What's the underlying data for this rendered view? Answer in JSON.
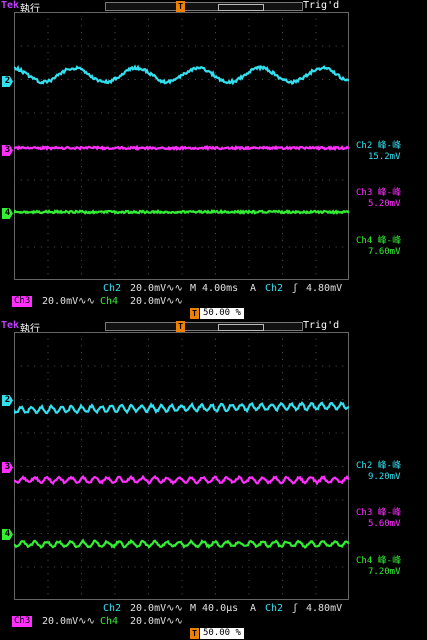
{
  "colors": {
    "ch2": "#33e0f0",
    "ch3": "#ff30ff",
    "ch4": "#33ee33",
    "tek": "#c040ff",
    "trigger": "#f08000"
  },
  "panels": [
    {
      "brand": "Tek",
      "run_state": "執行",
      "trig_state": "Trig'd",
      "trig_marker_label": "T",
      "trig_position": "",
      "channels": [
        {
          "label": "2",
          "wave": "sine-slow"
        },
        {
          "label": "3",
          "wave": "flat"
        },
        {
          "label": "4",
          "wave": "flat"
        }
      ],
      "measurements": [
        {
          "name": "Ch2 峰-峰",
          "value": "15.2mV",
          "color": "ch2"
        },
        {
          "name": "Ch3 峰-峰",
          "value": "5.20mV",
          "color": "ch3"
        },
        {
          "name": "Ch4 峰-峰",
          "value": "7.60mV",
          "color": "ch4"
        }
      ],
      "row1": {
        "ch2_label": "Ch2",
        "ch2_scale": "20.0mV∿∿",
        "timebase": "M 4.00ms",
        "trig_label": "A",
        "trig_ch": "Ch2",
        "trig_slope": "ʃ",
        "trig_level": "4.80mV"
      },
      "row2": {
        "ch3_label": "Ch3",
        "ch3_scale": "20.0mV∿∿",
        "ch4_label": "Ch4",
        "ch4_scale": "20.0mV∿∿"
      }
    },
    {
      "brand": "Tek",
      "run_state": "執行",
      "trig_state": "Trig'd",
      "trig_marker_label": "T",
      "trig_position": "50.00 %",
      "channels": [
        {
          "label": "2",
          "wave": "sine-fast"
        },
        {
          "label": "3",
          "wave": "ripple"
        },
        {
          "label": "4",
          "wave": "ripple"
        }
      ],
      "measurements": [
        {
          "name": "Ch2 峰-峰",
          "value": "9.20mV",
          "color": "ch2"
        },
        {
          "name": "Ch3 峰-峰",
          "value": "5.60mV",
          "color": "ch3"
        },
        {
          "name": "Ch4 峰-峰",
          "value": "7.20mV",
          "color": "ch4"
        }
      ],
      "row1": {
        "ch2_label": "Ch2",
        "ch2_scale": "20.0mV∿∿",
        "timebase": "M 40.0µs",
        "trig_label": "A",
        "trig_ch": "Ch2",
        "trig_slope": "ʃ",
        "trig_level": "4.80mV"
      },
      "row2": {
        "ch3_label": "Ch3",
        "ch3_scale": "20.0mV∿∿",
        "ch4_label": "Ch4",
        "ch4_scale": "20.0mV∿∿"
      }
    }
  ],
  "extra_top_trig_position": "50.00 %",
  "extra_bottom_trig_position": "50.00 %"
}
